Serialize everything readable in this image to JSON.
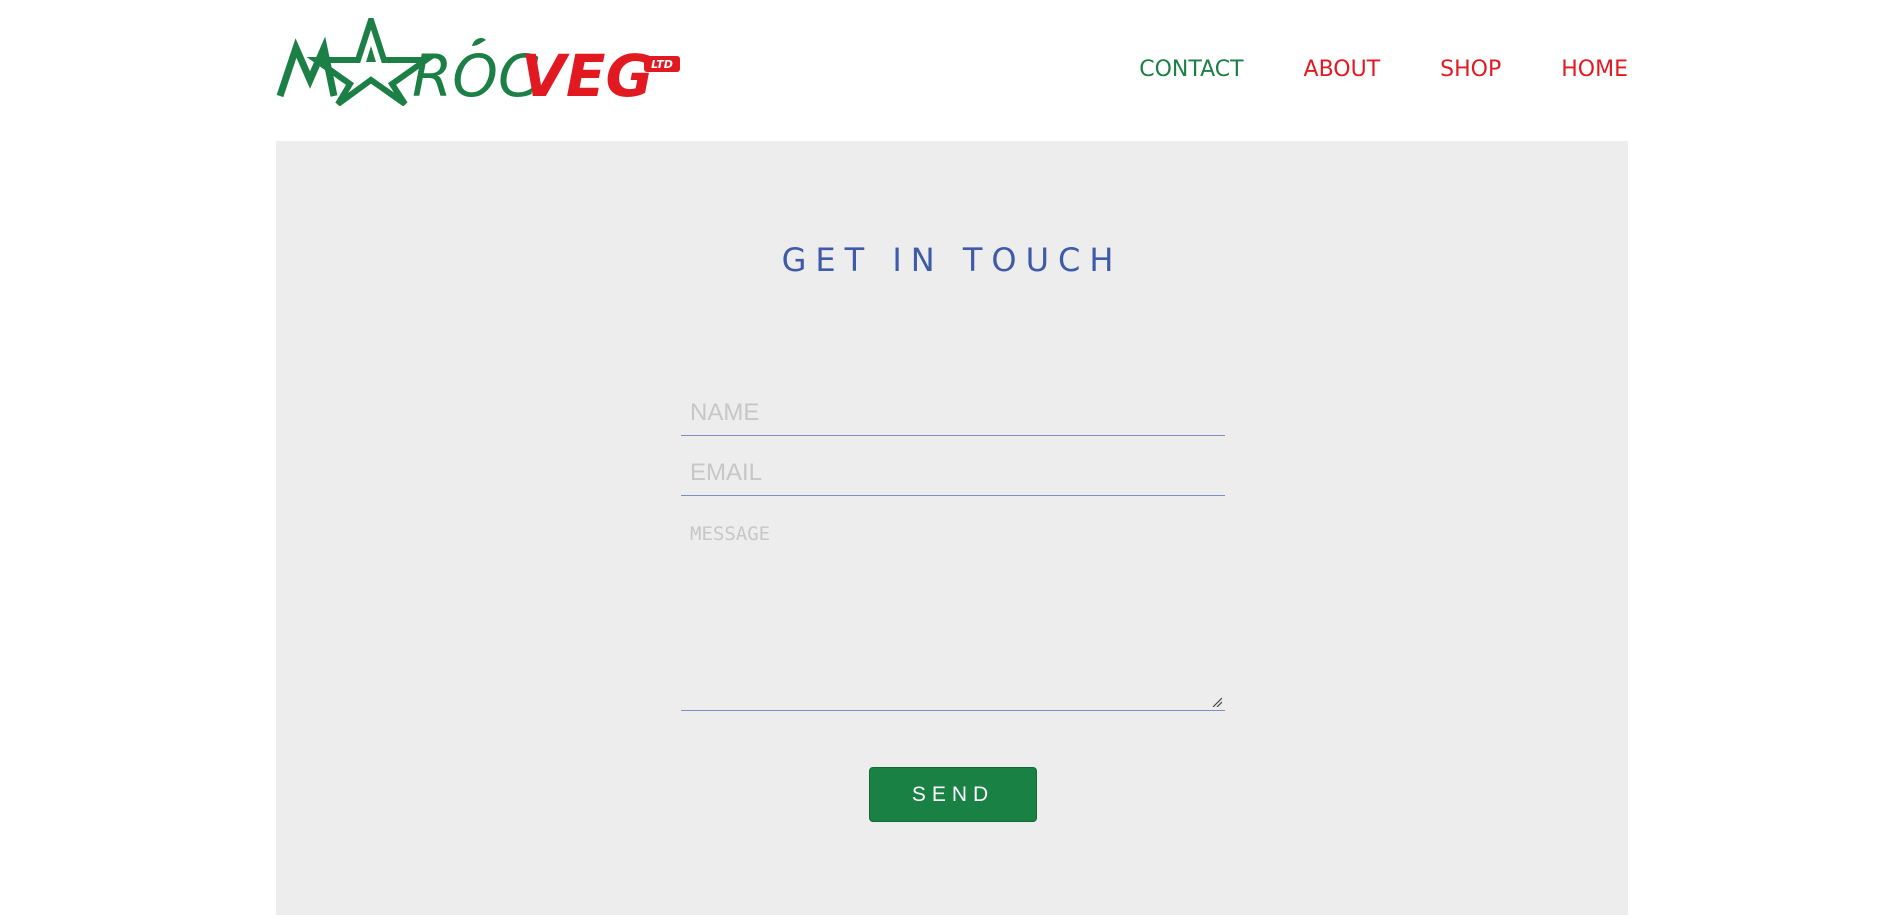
{
  "header": {
    "logo": {
      "text_green": "MAROC",
      "text_red": "VEG",
      "badge": "LTD",
      "green": "#1c7f45",
      "red": "#e11a22"
    },
    "nav": [
      {
        "label": "CONTACT",
        "active": true
      },
      {
        "label": "ABOUT",
        "active": false
      },
      {
        "label": "SHOP",
        "active": false
      },
      {
        "label": "HOME",
        "active": false
      }
    ]
  },
  "contact": {
    "title": "GET IN TOUCH",
    "fields": {
      "name": {
        "placeholder": "NAME",
        "value": ""
      },
      "email": {
        "placeholder": "EMAIL",
        "value": ""
      },
      "message": {
        "placeholder": "MESSAGE",
        "value": ""
      }
    },
    "send_label": "SEND"
  },
  "colors": {
    "accent_green": "#1a8145",
    "accent_red": "#e11a22",
    "title_blue": "#3f5aa8",
    "section_bg": "#ededed"
  },
  "icons": [
    "star-icon",
    "leaf-icon",
    "resize-grip-icon"
  ]
}
